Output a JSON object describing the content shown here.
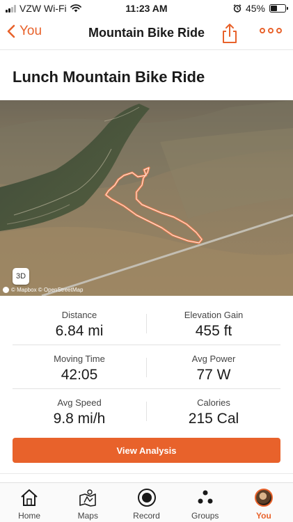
{
  "status_bar": {
    "carrier": "VZW Wi-Fi",
    "time": "11:23 AM",
    "battery": "45%",
    "battery_level": 0.45
  },
  "nav": {
    "back_label": "You",
    "title": "Mountain Bike Ride"
  },
  "activity": {
    "title": "Lunch Mountain Bike Ride"
  },
  "map": {
    "toggle_3d_label": "3D",
    "credit": "© Mapbox © OpenStreetMap"
  },
  "stats": {
    "distance": {
      "label": "Distance",
      "value": "6.84 mi"
    },
    "elevation_gain": {
      "label": "Elevation Gain",
      "value": "455 ft"
    },
    "moving_time": {
      "label": "Moving Time",
      "value": "42:05"
    },
    "avg_power": {
      "label": "Avg Power",
      "value": "77 W"
    },
    "avg_speed": {
      "label": "Avg Speed",
      "value": "9.8 mi/h"
    },
    "calories": {
      "label": "Calories",
      "value": "215 Cal"
    }
  },
  "actions": {
    "view_analysis_label": "View Analysis"
  },
  "tabbar": {
    "items": [
      {
        "label": "Home",
        "icon": "home-icon"
      },
      {
        "label": "Maps",
        "icon": "maps-icon"
      },
      {
        "label": "Record",
        "icon": "record-icon"
      },
      {
        "label": "Groups",
        "icon": "groups-icon"
      },
      {
        "label": "You",
        "icon": "avatar",
        "active": true
      }
    ]
  },
  "colors": {
    "accent": "#e8622b",
    "text": "#1a1a1a",
    "route": "#f08050"
  }
}
